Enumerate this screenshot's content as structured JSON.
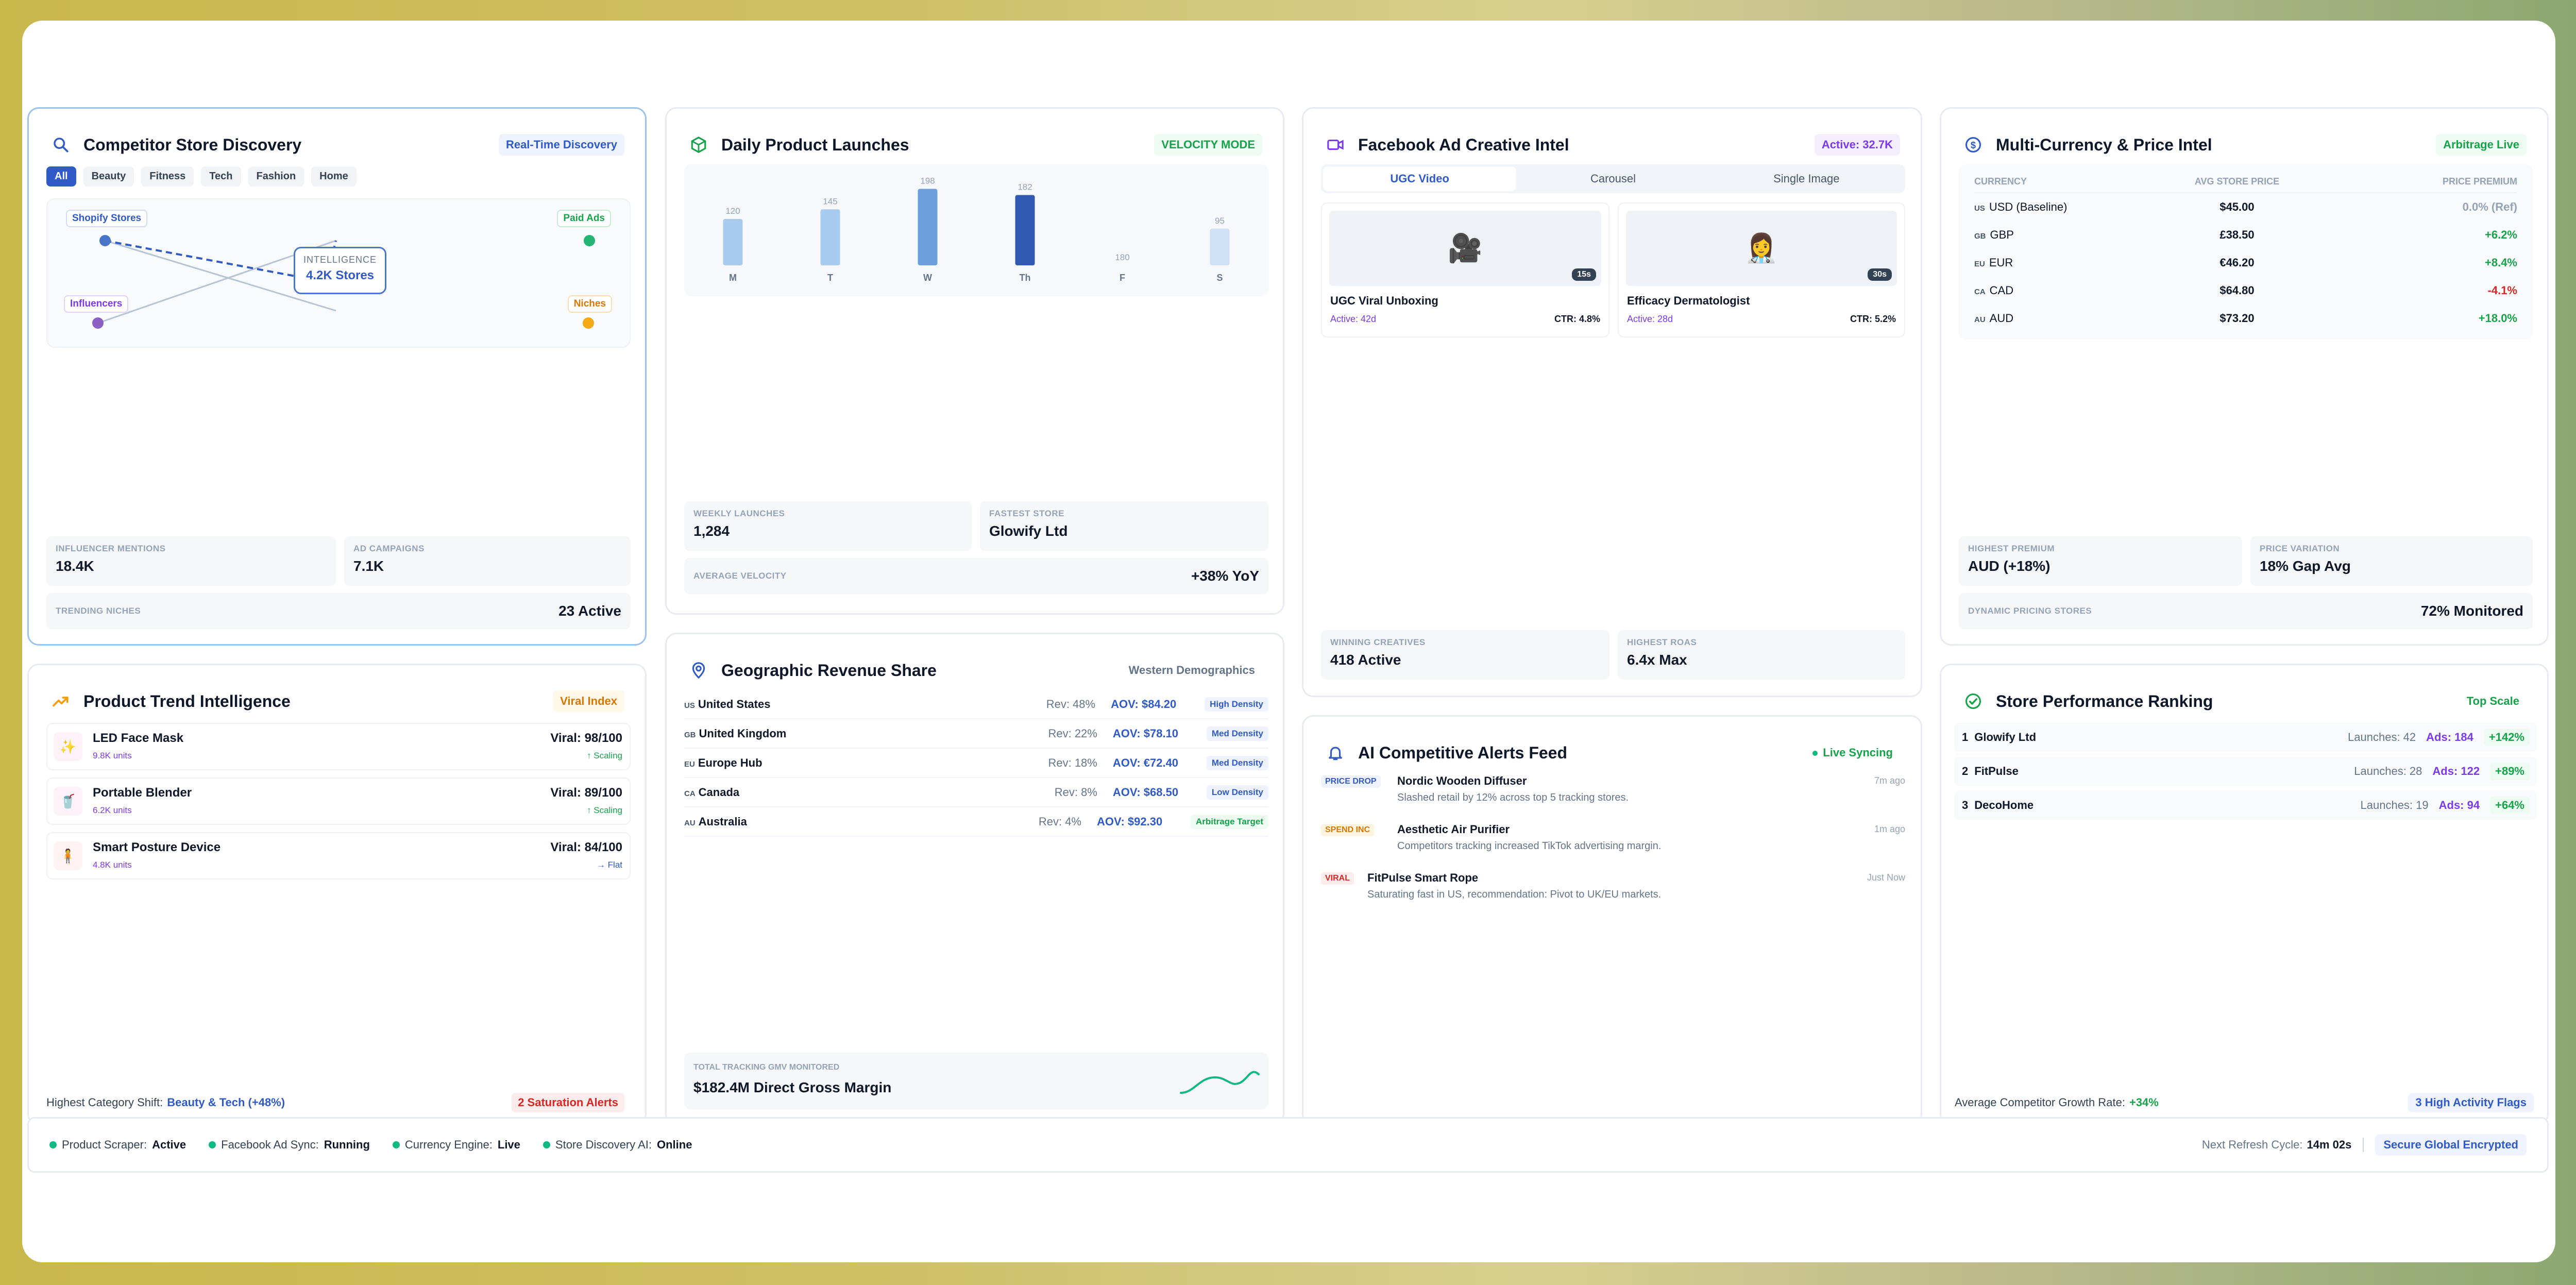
{
  "discovery": {
    "title": "Competitor Store Discovery",
    "badge": "Real-Time Discovery",
    "filters": [
      "All",
      "Beauty",
      "Fitness",
      "Tech",
      "Fashion",
      "Home"
    ],
    "nodes": {
      "shopify": "Shopify Stores",
      "paid_ads": "Paid Ads",
      "influencers": "Influencers",
      "niches": "Niches"
    },
    "center_label": "INTELLIGENCE",
    "center_value": "4.2K Stores",
    "stats": [
      {
        "label": "Influencer Mentions",
        "value": "18.4K"
      },
      {
        "label": "Ad Campaigns",
        "value": "7.1K"
      }
    ],
    "trending_label": "Trending Niches",
    "trending_value": "23 Active"
  },
  "launches": {
    "title": "Daily Product Launches",
    "badge": "VELOCITY MODE",
    "bars": [
      {
        "day": "M",
        "value": 120,
        "color": "#a9cbf0"
      },
      {
        "day": "T",
        "value": 145,
        "color": "#a9cbf0"
      },
      {
        "day": "W",
        "value": 198,
        "color": "#6d9fdc"
      },
      {
        "day": "Th",
        "value": 182,
        "color": "#2f5ab0"
      },
      {
        "day": "F",
        "value": 180,
        "color": "#a9cbf0"
      },
      {
        "day": "S",
        "value": 95,
        "color": "#cfe1f6"
      }
    ],
    "weekly_label": "Weekly Launches",
    "weekly_value": "1,284",
    "fastest_label": "Fastest Store",
    "fastest_value": "Glowify Ltd",
    "velocity_label": "Average Velocity",
    "velocity_value": "+38% YoY"
  },
  "ads": {
    "title": "Facebook Ad Creative Intel",
    "badge": "Active: 32.7K",
    "tabs": [
      "UGC Video",
      "Carousel",
      "Single Image"
    ],
    "creatives": [
      {
        "name": "UGC Viral Unboxing",
        "duration": "15s",
        "active": "Active: 42d",
        "ctr": "CTR: 4.8%",
        "icon": "🎥"
      },
      {
        "name": "Efficacy Dermatologist",
        "duration": "30s",
        "active": "Active: 28d",
        "ctr": "CTR: 5.2%",
        "icon": "👩‍⚕️"
      }
    ],
    "stats": [
      {
        "label": "Winning Creatives",
        "value": "418 Active"
      },
      {
        "label": "Highest ROAS",
        "value": "6.4x Max"
      }
    ]
  },
  "currency": {
    "title": "Multi-Currency & Price Intel",
    "badge": "Arbitrage Live",
    "headers": [
      "Currency",
      "Avg Store Price",
      "Price Premium"
    ],
    "rows": [
      {
        "flag": "US",
        "code": "USD (Baseline)",
        "price": "$45.00",
        "premium": "0.0% (Ref)",
        "tone": "muted"
      },
      {
        "flag": "GB",
        "code": "GBP",
        "price": "£38.50",
        "premium": "+6.2%",
        "tone": "green"
      },
      {
        "flag": "EU",
        "code": "EUR",
        "price": "€46.20",
        "premium": "+8.4%",
        "tone": "green"
      },
      {
        "flag": "CA",
        "code": "CAD",
        "price": "$64.80",
        "premium": "-4.1%",
        "tone": "red"
      },
      {
        "flag": "AU",
        "code": "AUD",
        "price": "$73.20",
        "premium": "+18.0%",
        "tone": "green"
      }
    ],
    "stats": [
      {
        "label": "Highest Premium",
        "value": "AUD (+18%)"
      },
      {
        "label": "Price Variation",
        "value": "18% Gap Avg"
      }
    ],
    "dynamic_label": "Dynamic Pricing Stores",
    "dynamic_value": "72% Monitored"
  },
  "trends": {
    "title": "Product Trend Intelligence",
    "badge": "Viral Index",
    "items": [
      {
        "name": "LED Face Mask",
        "units": "9.8K units",
        "score": "Viral: 98/100",
        "status": "↑ Scaling",
        "icon": "✨",
        "tone": "green"
      },
      {
        "name": "Portable Blender",
        "units": "6.2K units",
        "score": "Viral: 89/100",
        "status": "↑ Scaling",
        "icon": "🥤",
        "tone": "green"
      },
      {
        "name": "Smart Posture Device",
        "units": "4.8K units",
        "score": "Viral: 84/100",
        "status": "→ Flat",
        "icon": "🧍",
        "tone": "blue"
      }
    ],
    "footer_label": "Highest Category Shift:",
    "footer_value": "Beauty & Tech (+48%)",
    "alerts": "2 Saturation Alerts"
  },
  "geo": {
    "title": "Geographic Revenue Share",
    "badge": "Western Demographics",
    "rows": [
      {
        "flag": "US",
        "name": "United States",
        "rev": "Rev: 48%",
        "aov": "AOV: $84.20",
        "tag": "High Density",
        "tagtone": "blue"
      },
      {
        "flag": "GB",
        "name": "United Kingdom",
        "rev": "Rev: 22%",
        "aov": "AOV: $78.10",
        "tag": "Med Density",
        "tagtone": "blue"
      },
      {
        "flag": "EU",
        "name": "Europe Hub",
        "rev": "Rev: 18%",
        "aov": "AOV: €72.40",
        "tag": "Med Density",
        "tagtone": "blue"
      },
      {
        "flag": "CA",
        "name": "Canada",
        "rev": "Rev: 8%",
        "aov": "AOV: $68.50",
        "tag": "Low Density",
        "tagtone": "blue"
      },
      {
        "flag": "AU",
        "name": "Australia",
        "rev": "Rev: 4%",
        "aov": "AOV: $92.30",
        "tag": "Arbitrage Target",
        "tagtone": "green"
      }
    ],
    "total_label": "Total Tracking GMV Monitored",
    "total_value": "$182.4M Direct Gross Margin"
  },
  "alerts": {
    "title": "AI Competitive Alerts Feed",
    "badge": "Live Syncing",
    "items": [
      {
        "tag": "PRICE DROP",
        "tagtone": "blue",
        "title": "Nordic Wooden Diffuser",
        "desc": "Slashed retail by 12% across top 5 tracking stores.",
        "time": "7m ago"
      },
      {
        "tag": "SPEND INC",
        "tagtone": "orange",
        "title": "Aesthetic Air Purifier",
        "desc": "Competitors tracking increased TikTok advertising margin.",
        "time": "1m ago"
      },
      {
        "tag": "VIRAL",
        "tagtone": "red",
        "title": "FitPulse Smart Rope",
        "desc": "Saturating fast in US, recommendation: Pivot to UK/EU markets.",
        "time": "Just Now"
      }
    ]
  },
  "ranking": {
    "title": "Store Performance Ranking",
    "badge": "Top Scale",
    "rows": [
      {
        "rank": "1",
        "name": "Glowify Ltd",
        "launches": "Launches: 42",
        "ads": "Ads: 184",
        "growth": "+142%"
      },
      {
        "rank": "2",
        "name": "FitPulse",
        "launches": "Launches: 28",
        "ads": "Ads: 122",
        "growth": "+89%"
      },
      {
        "rank": "3",
        "name": "DecoHome",
        "launches": "Launches: 19",
        "ads": "Ads: 94",
        "growth": "+64%"
      }
    ],
    "footer_label": "Average Competitor Growth Rate:",
    "footer_value": "+34%",
    "flags": "3 High Activity Flags"
  },
  "status_bar": {
    "items": [
      {
        "label": "Product Scraper:",
        "value": "Active"
      },
      {
        "label": "Facebook Ad Sync:",
        "value": "Running"
      },
      {
        "label": "Currency Engine:",
        "value": "Live"
      },
      {
        "label": "Store Discovery AI:",
        "value": "Online"
      }
    ],
    "refresh_label": "Next Refresh Cycle:",
    "refresh_value": "14m 02s",
    "secure": "Secure Global Encrypted"
  },
  "colors": {
    "accent": "#2f5ac7",
    "green": "#16a34a",
    "red": "#dc2626",
    "purple": "#7c3aed",
    "orange": "#d97706"
  }
}
